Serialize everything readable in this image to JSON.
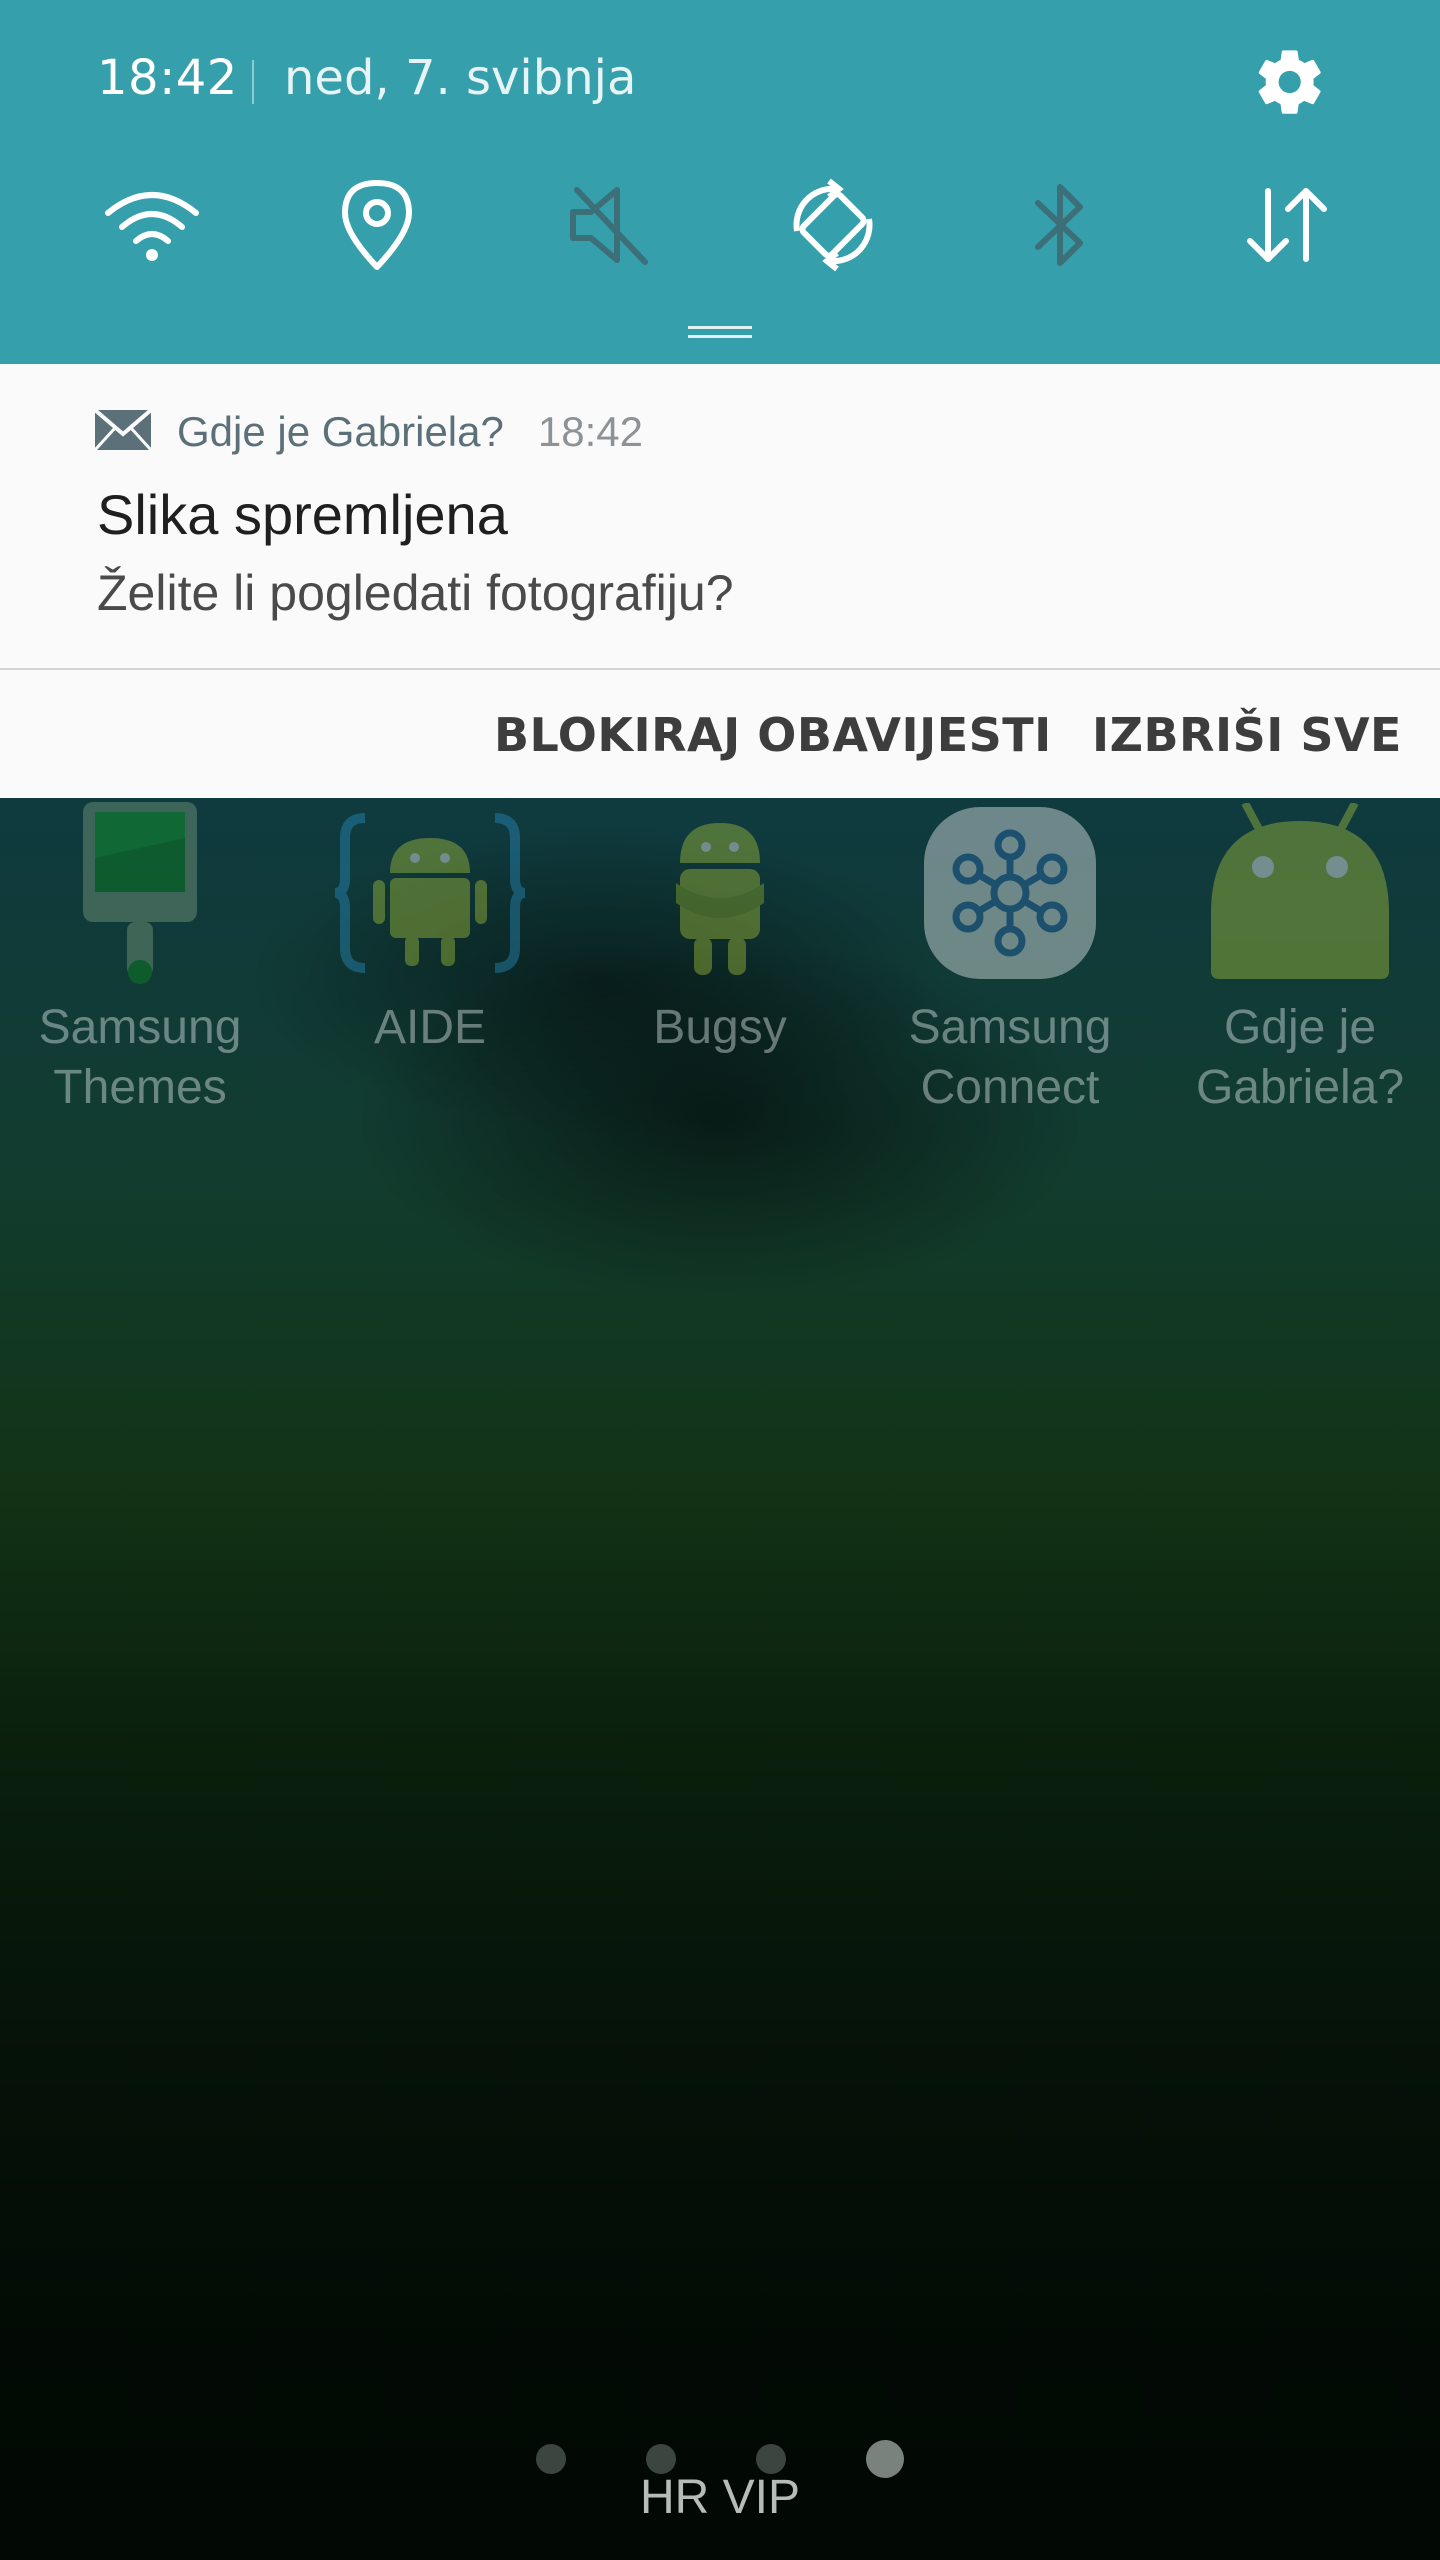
{
  "status": {
    "time": "18:42",
    "date": "ned, 7. svibnja"
  },
  "quick_settings": [
    {
      "name": "wifi",
      "icon": "wifi-icon"
    },
    {
      "name": "location",
      "icon": "location-icon"
    },
    {
      "name": "sound",
      "icon": "mute-icon"
    },
    {
      "name": "auto-rotate",
      "icon": "rotate-icon"
    },
    {
      "name": "bluetooth",
      "icon": "bluetooth-icon"
    },
    {
      "name": "mobile-data",
      "icon": "data-arrows-icon"
    }
  ],
  "notification": {
    "app_icon": "mail-icon",
    "app_name": "Gdje je Gabriela?",
    "time": "18:42",
    "title": "Slika spremljena",
    "text": "Želite li pogledati fotografiju?"
  },
  "actions": {
    "block_label": "BLOKIRAJ OBAVIJESTI",
    "clear_label": "IZBRIŠI SVE"
  },
  "home_apps": [
    {
      "label": "Samsung\nThemes",
      "icon": "samsung-themes-icon"
    },
    {
      "label": "AIDE",
      "icon": "aide-icon"
    },
    {
      "label": "Bugsy",
      "icon": "bugsy-icon"
    },
    {
      "label": "Samsung\nConnect",
      "icon": "samsung-connect-icon"
    },
    {
      "label": "Gdje je\nGabriela?",
      "icon": "android-app-icon"
    }
  ],
  "home_pages": {
    "count": 4,
    "active_index": 3
  },
  "carrier": "HR VIP",
  "colors": {
    "panel": "#359fac",
    "card": "#fafafa",
    "accent_text": "#5b7079"
  }
}
